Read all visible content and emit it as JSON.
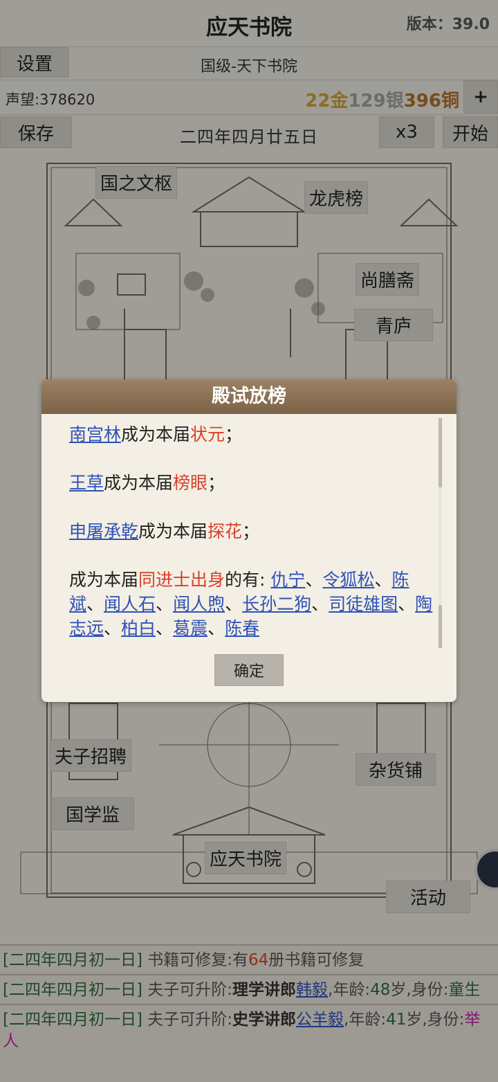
{
  "header": {
    "title": "应天书院",
    "version": "版本：39.0"
  },
  "toolbar": {
    "settings_label": "设置",
    "subtitle": "国级-天下书院",
    "reputation": "声望:378620",
    "gold": "22金",
    "silver": "129银",
    "copper": "396铜",
    "add_label": "+",
    "save_label": "保存",
    "date": "二四年四月廿五日",
    "speed_label": "x3",
    "start_label": "开始"
  },
  "map": {
    "places": [
      "国之文枢",
      "龙虎榜",
      "尚膳斋",
      "青庐",
      "夫子招聘",
      "杂货铺",
      "国学监",
      "应天书院",
      "活动"
    ]
  },
  "dialog": {
    "title": "殿试放榜",
    "zhuangyuan_name": "南宫林",
    "zhuangyuan_text": "成为本届",
    "zhuangyuan_title": "状元",
    "zhuangyuan_end": "；",
    "bangyan_name": "王草",
    "bangyan_text": "成为本届",
    "bangyan_title": "榜眼",
    "bangyan_end": "；",
    "tanhua_name": "申屠承乾",
    "tanhua_text": "成为本届",
    "tanhua_title": "探花",
    "tanhua_end": "；",
    "tongjinshi_prefix": "成为本届",
    "tongjinshi_title": "同进士出身",
    "tongjinshi_suffix": "的有:",
    "tongjinshi_names": [
      "仇宁",
      "令狐松",
      "陈斌",
      "闻人石",
      "闻人煦",
      "长孙二狗",
      "司徒雄图",
      "陶志远",
      "柏白",
      "葛震",
      "陈春"
    ],
    "separator": "、",
    "confirm_label": "确定"
  },
  "log": {
    "entries": [
      {
        "date": "[二四年四月初一日]",
        "a": " 书籍可修复:有",
        "num": "64",
        "b": "册书籍可修复"
      },
      {
        "date": "[二四年四月初一日]",
        "a": " 夫子可升阶:",
        "rank": "理学讲郎",
        "name": "韩毅",
        "b": ",年龄:",
        "age": "48",
        "c": "岁,身份:",
        "identity": "童生"
      },
      {
        "date": "[二四年四月初一日]",
        "a": " 夫子可升阶:",
        "rank": "史学讲郎",
        "name": "公羊毅",
        "b": ",年龄:",
        "age": "41",
        "c": "岁,身份:",
        "identity": "举人"
      }
    ]
  }
}
